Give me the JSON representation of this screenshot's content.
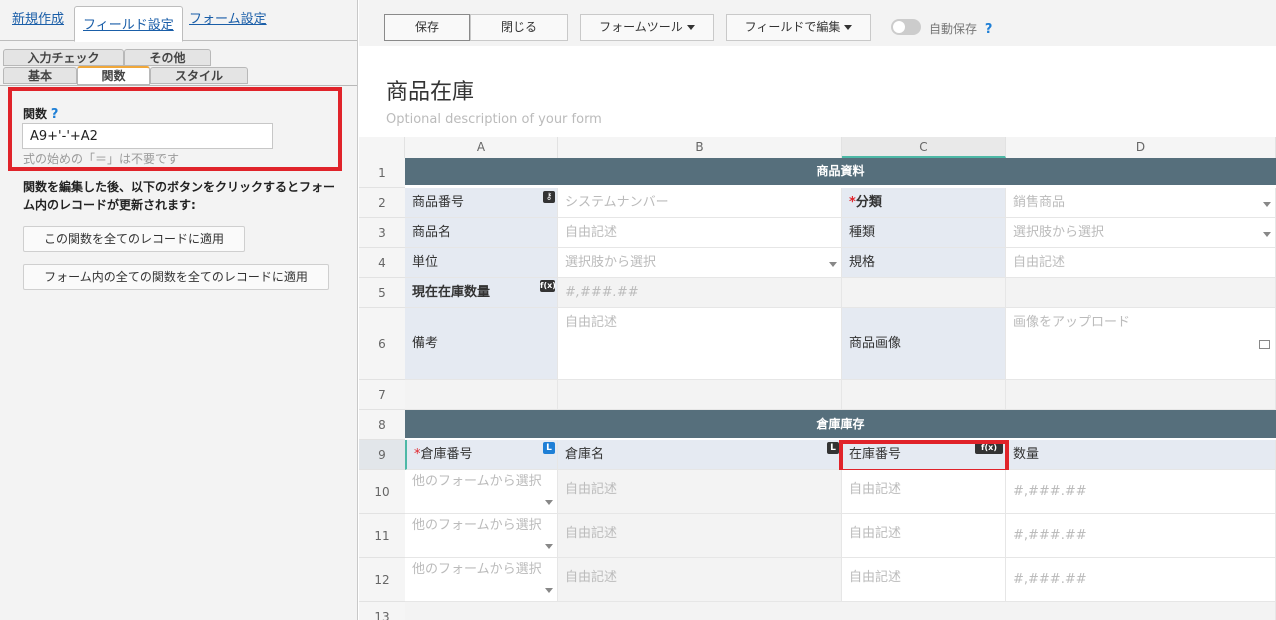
{
  "left": {
    "top_tabs": [
      "新規作成",
      "フィールド設定",
      "フォーム設定"
    ],
    "sub_tabs_row1": [
      "入力チェック",
      "その他"
    ],
    "sub_tabs_row2": [
      "基本",
      "関数",
      "スタイル"
    ],
    "function_label": "関数",
    "help": "?",
    "formula_value": "A9+'-'+A2",
    "hint": "式の始めの「＝」は不要です",
    "description": "関数を編集した後、以下のボタンをクリックするとフォーム内のレコードが更新されます:",
    "apply_button": "この関数を全てのレコードに適用",
    "apply_all_button": "フォーム内の全ての関数を全てのレコードに適用"
  },
  "toolbar": {
    "save": "保存",
    "close": "閉じる",
    "form_tools": "フォームツール",
    "edit_by_field": "フィールドで編集",
    "autosave": "自動保存",
    "help": "?"
  },
  "form": {
    "title": "商品在庫",
    "description_placeholder": "Optional description of your form"
  },
  "columns": [
    "A",
    "B",
    "C",
    "D"
  ],
  "rows": [
    "1",
    "2",
    "3",
    "4",
    "5",
    "6",
    "7",
    "8",
    "9",
    "10",
    "11",
    "12",
    "13"
  ],
  "grid": {
    "section1": "商品資料",
    "r2": {
      "a": "商品番号",
      "b": "システムナンバー",
      "c_req": "*",
      "c": "分類",
      "d": "銷售商品"
    },
    "r3": {
      "a": "商品名",
      "b": "自由記述",
      "c": "種類",
      "d": "選択肢から選択"
    },
    "r4": {
      "a": "単位",
      "b": "選択肢から選択",
      "c": "規格",
      "d": "自由記述"
    },
    "r5": {
      "a": "現在在庫数量",
      "b": "#,###.##"
    },
    "r6": {
      "a": "備考",
      "b": "自由記述",
      "c": "商品画像",
      "d": "画像をアップロード"
    },
    "section2": "倉庫庫存",
    "r9": {
      "a_req": "*",
      "a": "倉庫番号",
      "b": "倉庫名",
      "c": "在庫番号",
      "d": "数量"
    },
    "sub_rows": [
      {
        "a": "他のフォームから選択",
        "b": "自由記述",
        "c": "自由記述",
        "d": "#,###.##"
      },
      {
        "a": "他のフォームから選択",
        "b": "自由記述",
        "c": "自由記述",
        "d": "#,###.##"
      },
      {
        "a": "他のフォームから選択",
        "b": "自由記述",
        "c": "自由記述",
        "d": "#,###.##"
      }
    ],
    "badge_l": "L",
    "badge_fx": "f(x)"
  },
  "colors": {
    "accent": "#e0232a",
    "section": "#566f7c",
    "label_bg": "#e5eaf2",
    "link": "#1a5ea8"
  }
}
